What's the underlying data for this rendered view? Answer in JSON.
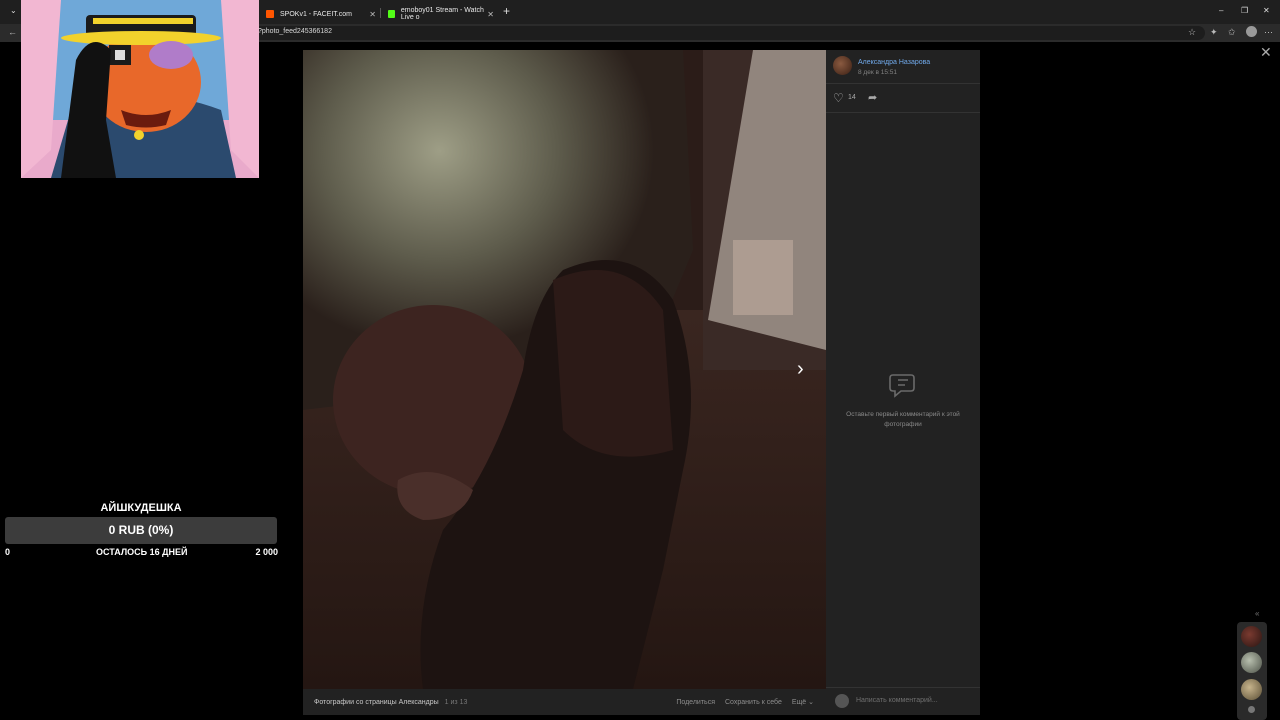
{
  "browser": {
    "tabs": [
      {
        "title": "SPOKv1 - FACEIT.com"
      },
      {
        "title": "emoboy01 Stream - Watch Live o"
      }
    ],
    "new_tab": "+",
    "url": "?photo_feed245366182",
    "controls": {
      "minimize": "–",
      "restore": "❐",
      "close": "✕"
    },
    "tab_close": "✕",
    "nav_back": "←",
    "menu": "⋯"
  },
  "donation": {
    "title": "АЙШКУДЕШКА",
    "progress_text": "0 RUB (0%)",
    "progress_fraction": 0,
    "min": "0",
    "remaining": "ОСТАЛОСЬ 16 ДНЕЙ",
    "max": "2 000"
  },
  "viewer": {
    "close": "✕",
    "next": "›",
    "author": {
      "name": "Александра Назарова",
      "date": "8 дек в 15:51"
    },
    "likes": "14",
    "empty_comments": "Оставьте первый комментарий к этой фотографии",
    "comment_placeholder": "Написать комментарий...",
    "album_title": "Фотографии со страницы Александры",
    "counter": "1 из 13",
    "actions": {
      "share": "Поделиться",
      "save": "Сохранить к себе",
      "more": "Ещё ⌄"
    }
  },
  "rail": {
    "collapse": "«"
  },
  "colors": {
    "link": "#71aaeb",
    "panel": "#222222",
    "chrome": "#1f1f1f"
  }
}
